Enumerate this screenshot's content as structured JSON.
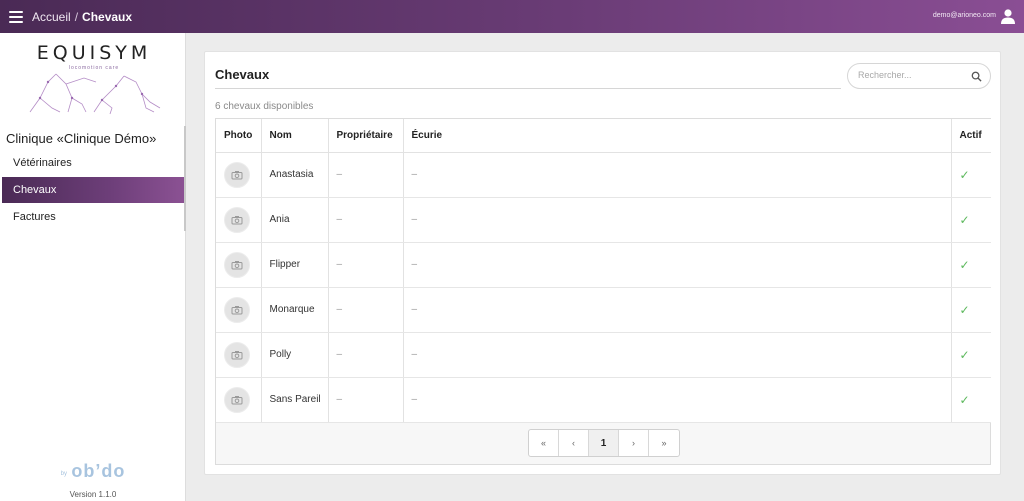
{
  "topbar": {
    "breadcrumb_home": "Accueil",
    "breadcrumb_sep": "/",
    "breadcrumb_current": "Chevaux",
    "user_email": "demo@arioneo.com",
    "hamburger_icon": "menu-icon",
    "user_icon": "user-icon",
    "gradient_colors": [
      "#4a2a55",
      "#8a4e94"
    ]
  },
  "sidebar": {
    "logo_text": "EQUISYM",
    "logo_subtitle": "locomotion care",
    "clinic_title": "Clinique «Clinique Démo»",
    "items": [
      {
        "label": "Vétérinaires",
        "active": false
      },
      {
        "label": "Chevaux",
        "active": true
      },
      {
        "label": "Factures",
        "active": false
      }
    ],
    "footer_by": "by",
    "footer_brand": "ob’do",
    "version": "Version 1.1.0"
  },
  "main": {
    "title": "Chevaux",
    "search_placeholder": "Rechercher...",
    "count_text": "6 chevaux disponibles",
    "columns": [
      "Photo",
      "Nom",
      "Propriétaire",
      "Écurie",
      "Actif"
    ],
    "rows": [
      {
        "name": "Anastasia",
        "owner": "–",
        "stable": "–",
        "active": "✓"
      },
      {
        "name": "Ania",
        "owner": "–",
        "stable": "–",
        "active": "✓"
      },
      {
        "name": "Flipper",
        "owner": "–",
        "stable": "–",
        "active": "✓"
      },
      {
        "name": "Monarque",
        "owner": "–",
        "stable": "–",
        "active": "✓"
      },
      {
        "name": "Polly",
        "owner": "–",
        "stable": "–",
        "active": "✓"
      },
      {
        "name": "Sans Pareil",
        "owner": "–",
        "stable": "–",
        "active": "✓"
      }
    ],
    "pagination": {
      "first": "«",
      "prev": "‹",
      "current": "1",
      "next": "›",
      "last": "»"
    },
    "accent_check_color": "#5cb85c"
  }
}
